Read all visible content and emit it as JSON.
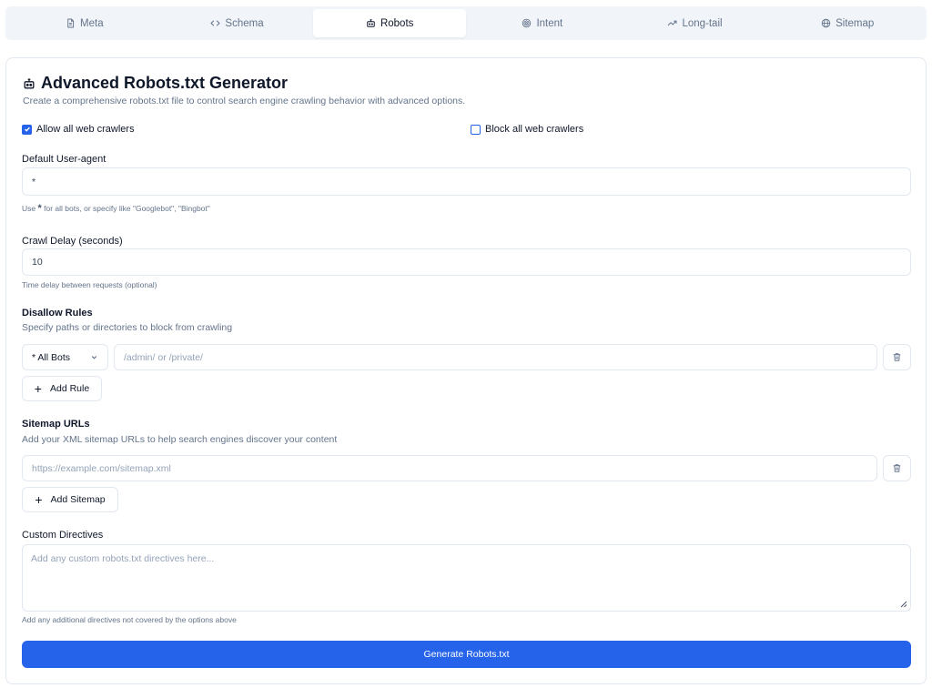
{
  "tabs": [
    {
      "label": "Meta",
      "icon": "file-icon",
      "active": false
    },
    {
      "label": "Schema",
      "icon": "code-icon",
      "active": false
    },
    {
      "label": "Robots",
      "icon": "bot-icon",
      "active": true
    },
    {
      "label": "Intent",
      "icon": "target-icon",
      "active": false
    },
    {
      "label": "Long-tail",
      "icon": "trending-icon",
      "active": false
    },
    {
      "label": "Sitemap",
      "icon": "globe-icon",
      "active": false
    }
  ],
  "header": {
    "title": "Advanced Robots.txt Generator",
    "subtitle": "Create a comprehensive robots.txt file to control search engine crawling behavior with advanced options."
  },
  "crawlers": {
    "allow_label": "Allow all web crawlers",
    "allow_checked": true,
    "block_label": "Block all web crawlers",
    "block_checked": false
  },
  "user_agent": {
    "label": "Default User-agent",
    "value": "*",
    "help_prefix": "Use",
    "help_star": "*",
    "help_suffix": "for all bots, or specify like \"Googlebot\", \"Bingbot\""
  },
  "crawl_delay": {
    "label": "Crawl Delay (seconds)",
    "value": "10",
    "help": "Time delay between requests (optional)"
  },
  "disallow": {
    "title": "Disallow Rules",
    "description": "Specify paths or directories to block from crawling",
    "bot_select": "* All Bots",
    "path_placeholder": "/admin/ or /private/",
    "add_label": "Add Rule"
  },
  "sitemap": {
    "title": "Sitemap URLs",
    "description": "Add your XML sitemap URLs to help search engines discover your content",
    "url_placeholder": "https://example.com/sitemap.xml",
    "add_label": "Add Sitemap"
  },
  "custom": {
    "label": "Custom Directives",
    "placeholder": "Add any custom robots.txt directives here...",
    "help": "Add any additional directives not covered by the options above"
  },
  "generate_label": "Generate Robots.txt",
  "colors": {
    "accent": "#2563eb",
    "muted": "#64748b",
    "border": "#e2e8f0"
  }
}
